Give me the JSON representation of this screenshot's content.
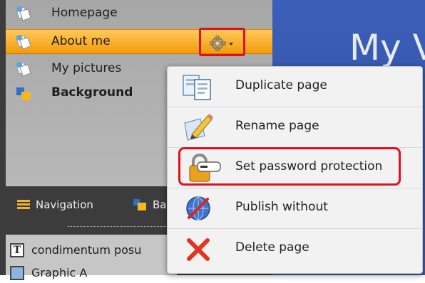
{
  "page_tree": {
    "items": [
      {
        "label": "Homepage",
        "selected": false,
        "bold": false
      },
      {
        "label": "About me",
        "selected": true,
        "bold": false
      },
      {
        "label": "My pictures",
        "selected": false,
        "bold": false
      },
      {
        "label": "Background",
        "selected": false,
        "bold": true
      }
    ]
  },
  "tabs": [
    {
      "label": "Navigation",
      "icon": "navigation-icon"
    },
    {
      "label": "Ba",
      "icon": "background-icon"
    }
  ],
  "elements": [
    {
      "label": "condimentum posu",
      "icon": "text-icon"
    },
    {
      "label": "Graphic A",
      "icon": "graphic-icon"
    }
  ],
  "preview": {
    "title_fragment": "My V"
  },
  "context_menu": {
    "items": [
      {
        "label": "Duplicate page",
        "icon": "duplicate-icon"
      },
      {
        "label": "Rename page",
        "icon": "rename-icon"
      },
      {
        "label": "Set password protection",
        "icon": "lock-icon",
        "highlighted": true
      },
      {
        "label": "Publish without",
        "icon": "publish-icon"
      },
      {
        "label": "Delete page",
        "icon": "delete-icon"
      }
    ]
  },
  "colors": {
    "selected_row": "#f49c0a",
    "highlight_border": "#e0101e",
    "preview_bg": "#3453a8"
  }
}
